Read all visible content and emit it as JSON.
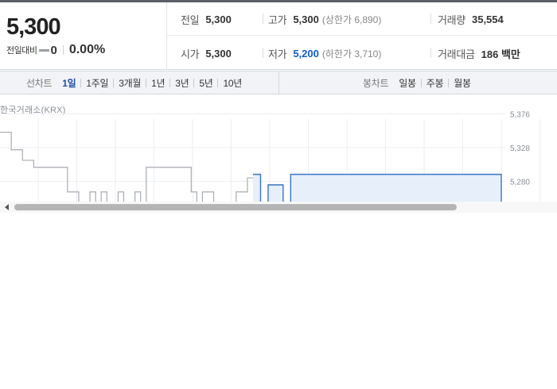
{
  "quote": {
    "price": "5,300",
    "change_label": "전일대비",
    "change_value": "0",
    "change_rate": "0.00%",
    "row1": {
      "prev_label": "전일",
      "prev_value": "5,300",
      "high_label": "고가",
      "high_value": "5,300",
      "upper_limit": "(상한가 6,890)",
      "volume_label": "거래량",
      "volume_value": "35,554"
    },
    "row2": {
      "open_label": "시가",
      "open_value": "5,300",
      "low_label": "저가",
      "low_value": "5,200",
      "lower_limit": "(하한가 3,710)",
      "amount_label": "거래대금",
      "amount_value": "186 백만"
    },
    "colors": {
      "low_price": "#1060c8",
      "active_period": "#1f4fb0"
    }
  },
  "periods": {
    "line_title": "선차트",
    "line_items": [
      {
        "label": "1일",
        "active": true
      },
      {
        "label": "1주일",
        "active": false
      },
      {
        "label": "3개월",
        "active": false
      },
      {
        "label": "1년",
        "active": false
      },
      {
        "label": "3년",
        "active": false
      },
      {
        "label": "5년",
        "active": false
      },
      {
        "label": "10년",
        "active": false
      }
    ],
    "candle_title": "봉차트",
    "candle_items": [
      {
        "label": "일봉"
      },
      {
        "label": "주봉"
      },
      {
        "label": "월봉"
      }
    ]
  },
  "source": "한국거래소(KRX)",
  "chart_data": {
    "type": "line",
    "ylim": [
      5250,
      5380
    ],
    "y_ticks": [
      "5,376",
      "5,328",
      "5,280"
    ],
    "series": [
      {
        "color": "#a7abb2",
        "values": [
          5350,
          5350,
          5325,
          5325,
          5310,
          5310,
          5300,
          5300,
          5300,
          5300,
          5300,
          5300,
          5265,
          5265,
          5250,
          5250,
          5265,
          5250,
          5265,
          5250,
          5250,
          5265,
          5250,
          5250,
          5265,
          5250,
          5300,
          5300,
          5300,
          5300,
          5300,
          5300,
          5300,
          5300,
          5265,
          5250,
          5265,
          5265,
          5250,
          5250,
          5250,
          5250,
          5265,
          5265,
          5285,
          5285
        ]
      },
      {
        "color": "#3b73c8",
        "fill": "#e6effa",
        "values": [
          5290,
          5250,
          5275,
          5275,
          5250,
          5290,
          5290,
          5290,
          5290,
          5290,
          5290,
          5290,
          5290,
          5290,
          5290,
          5290,
          5290,
          5290,
          5290,
          5290,
          5290,
          5290,
          5290,
          5290,
          5290,
          5290,
          5290,
          5290,
          5290,
          5290,
          5290,
          5290,
          5290,
          5250
        ]
      }
    ]
  }
}
